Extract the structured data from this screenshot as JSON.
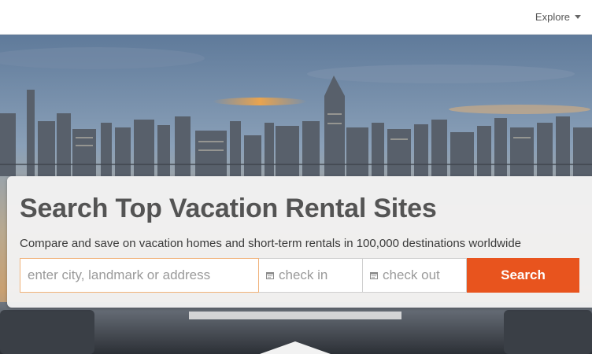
{
  "nav": {
    "explore_label": "Explore"
  },
  "hero": {
    "headline": "Search Top Vacation Rental Sites",
    "subline": "Compare and save on vacation homes and short-term rentals in 100,000 destinations worldwide"
  },
  "search": {
    "location_placeholder": "enter city, landmark or address",
    "checkin_placeholder": "check in",
    "checkout_placeholder": "check out",
    "button_label": "Search"
  },
  "colors": {
    "accent": "#e8541e",
    "headline": "#545454"
  }
}
